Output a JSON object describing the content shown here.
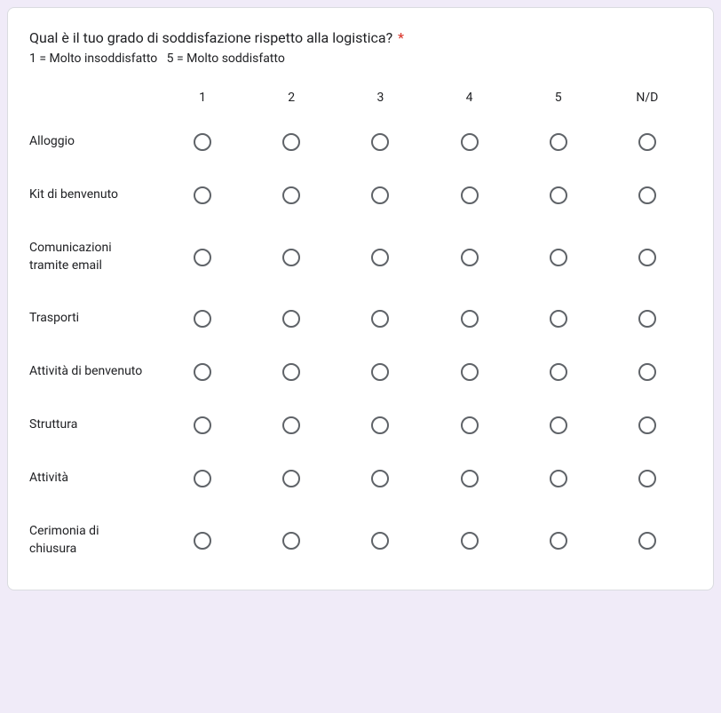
{
  "question": {
    "title": "Qual è il tuo grado di soddisfazione rispetto alla logistica?",
    "required_marker": "*",
    "legend": "1 = Molto insoddisfatto   5 = Molto soddisfatto"
  },
  "columns": [
    "1",
    "2",
    "3",
    "4",
    "5",
    "N/D"
  ],
  "rows": [
    {
      "label": "Alloggio"
    },
    {
      "label": "Kit di benvenuto"
    },
    {
      "label": "Comunicazioni tramite email"
    },
    {
      "label": "Trasporti"
    },
    {
      "label": "Attività di benvenuto"
    },
    {
      "label": "Struttura"
    },
    {
      "label": "Attività"
    },
    {
      "label": "Cerimonia di chiusura"
    }
  ]
}
